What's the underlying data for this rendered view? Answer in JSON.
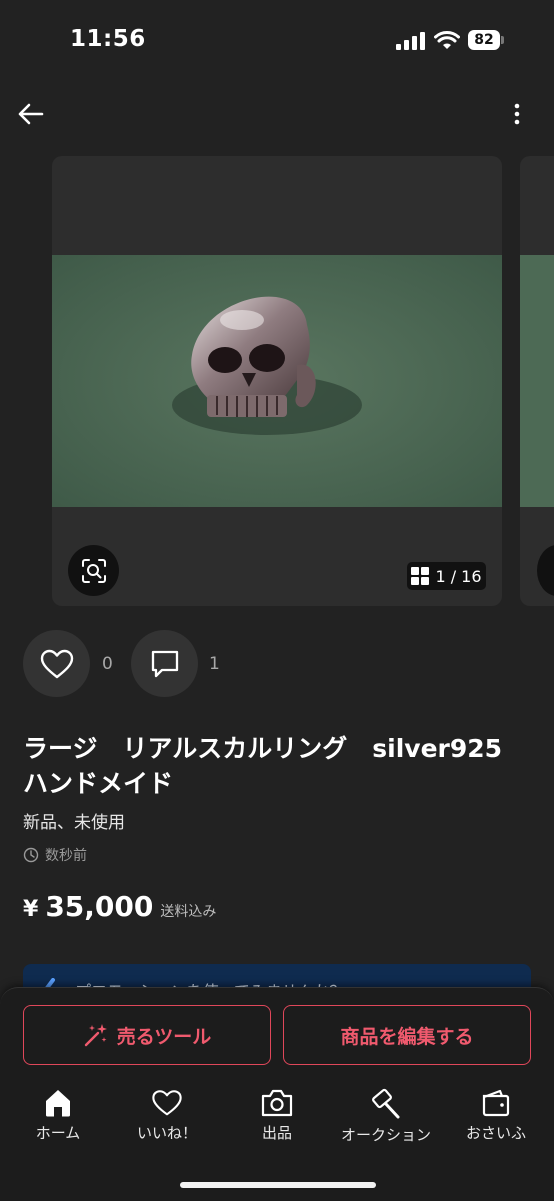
{
  "status_bar": {
    "time": "11:56",
    "battery": "82"
  },
  "gallery": {
    "counter": "1 / 16"
  },
  "reactions": {
    "likes": "0",
    "comments": "1"
  },
  "item": {
    "title": "ラージ　リアルスカルリング　silver925　ハンドメイド",
    "condition": "新品、未使用",
    "posted": "数秒前",
    "price_symbol": "¥",
    "price": "35,000",
    "shipping": "送料込み"
  },
  "promo": {
    "text": "プロモーションを使ってみませんか？"
  },
  "actions": {
    "sell_tools": "売るツール",
    "edit_item": "商品を編集する"
  },
  "tabs": [
    {
      "label": "ホーム",
      "icon": "home-icon"
    },
    {
      "label": "いいね！",
      "icon": "heart-icon"
    },
    {
      "label": "出品",
      "icon": "camera-icon"
    },
    {
      "label": "オークション",
      "icon": "gavel-icon"
    },
    {
      "label": "おさいふ",
      "icon": "wallet-icon"
    }
  ],
  "colors": {
    "background": "#222222",
    "accent": "#e0475a",
    "promo": "#0f2b4f"
  }
}
